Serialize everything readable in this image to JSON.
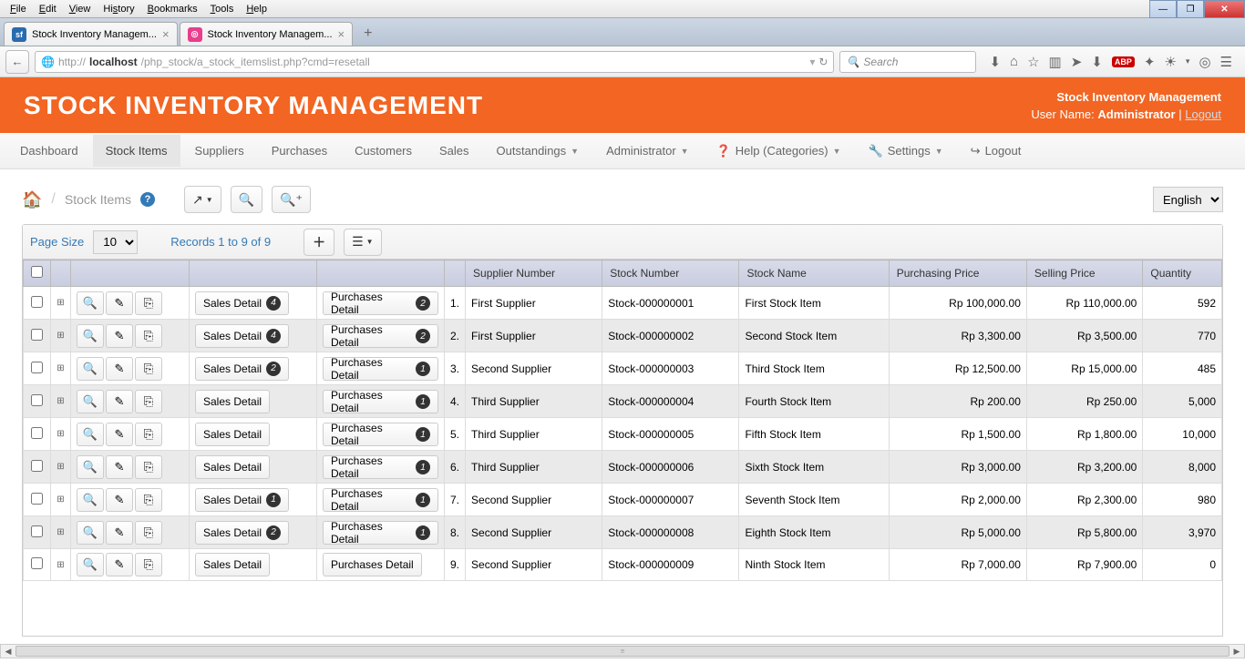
{
  "os_menu": [
    "File",
    "Edit",
    "View",
    "History",
    "Bookmarks",
    "Tools",
    "Help"
  ],
  "browser": {
    "tabs": [
      {
        "label": "Stock Inventory Managem...",
        "fav_bg": "#2a6aae",
        "fav_tx": "sf"
      },
      {
        "label": "Stock Inventory Managem...",
        "fav_bg": "#e83e8c",
        "fav_tx": "◎"
      }
    ],
    "url_scheme": "http://",
    "url_host": "localhost",
    "url_path": "/php_stock/a_stock_itemslist.php?cmd=resetall",
    "search_placeholder": "Search"
  },
  "header": {
    "title": "STOCK INVENTORY MANAGEMENT",
    "right_title": "Stock Inventory Management",
    "user_label": "User Name:",
    "user_name": "Administrator",
    "logout": "Logout"
  },
  "nav": {
    "dashboard": "Dashboard",
    "stock_items": "Stock Items",
    "suppliers": "Suppliers",
    "purchases": "Purchases",
    "customers": "Customers",
    "sales": "Sales",
    "outstandings": "Outstandings",
    "administrator": "Administrator",
    "help": "Help (Categories)",
    "settings": "Settings",
    "logout": "Logout"
  },
  "breadcrumb": {
    "current": "Stock Items"
  },
  "language": "English",
  "paging": {
    "page_size_label": "Page Size",
    "page_size": "10",
    "records_info": "Records 1 to 9 of 9"
  },
  "columns": {
    "supplier": "Supplier Number",
    "stock_no": "Stock Number",
    "stock_name": "Stock Name",
    "purchase": "Purchasing Price",
    "selling": "Selling Price",
    "qty": "Quantity"
  },
  "labels": {
    "sales_detail": "Sales Detail",
    "purchases_detail": "Purchases Detail"
  },
  "rows": [
    {
      "n": "1.",
      "supplier": "First Supplier",
      "stock_no": "Stock-000000001",
      "stock_name": "First Stock Item",
      "purchase": "Rp 100,000.00",
      "selling": "Rp 110,000.00",
      "qty": "592",
      "sales_badge": "4",
      "purch_badge": "2"
    },
    {
      "n": "2.",
      "supplier": "First Supplier",
      "stock_no": "Stock-000000002",
      "stock_name": "Second Stock Item",
      "purchase": "Rp 3,300.00",
      "selling": "Rp 3,500.00",
      "qty": "770",
      "sales_badge": "4",
      "purch_badge": "2"
    },
    {
      "n": "3.",
      "supplier": "Second Supplier",
      "stock_no": "Stock-000000003",
      "stock_name": "Third Stock Item",
      "purchase": "Rp 12,500.00",
      "selling": "Rp 15,000.00",
      "qty": "485",
      "sales_badge": "2",
      "purch_badge": "1"
    },
    {
      "n": "4.",
      "supplier": "Third Supplier",
      "stock_no": "Stock-000000004",
      "stock_name": "Fourth Stock Item",
      "purchase": "Rp 200.00",
      "selling": "Rp 250.00",
      "qty": "5,000",
      "sales_badge": "",
      "purch_badge": "1"
    },
    {
      "n": "5.",
      "supplier": "Third Supplier",
      "stock_no": "Stock-000000005",
      "stock_name": "Fifth Stock Item",
      "purchase": "Rp 1,500.00",
      "selling": "Rp 1,800.00",
      "qty": "10,000",
      "sales_badge": "",
      "purch_badge": "1"
    },
    {
      "n": "6.",
      "supplier": "Third Supplier",
      "stock_no": "Stock-000000006",
      "stock_name": "Sixth Stock Item",
      "purchase": "Rp 3,000.00",
      "selling": "Rp 3,200.00",
      "qty": "8,000",
      "sales_badge": "",
      "purch_badge": "1"
    },
    {
      "n": "7.",
      "supplier": "Second Supplier",
      "stock_no": "Stock-000000007",
      "stock_name": "Seventh Stock Item",
      "purchase": "Rp 2,000.00",
      "selling": "Rp 2,300.00",
      "qty": "980",
      "sales_badge": "1",
      "purch_badge": "1"
    },
    {
      "n": "8.",
      "supplier": "Second Supplier",
      "stock_no": "Stock-000000008",
      "stock_name": "Eighth Stock Item",
      "purchase": "Rp 5,000.00",
      "selling": "Rp 5,800.00",
      "qty": "3,970",
      "sales_badge": "2",
      "purch_badge": "1"
    },
    {
      "n": "9.",
      "supplier": "Second Supplier",
      "stock_no": "Stock-000000009",
      "stock_name": "Ninth Stock Item",
      "purchase": "Rp 7,000.00",
      "selling": "Rp 7,900.00",
      "qty": "0",
      "sales_badge": "",
      "purch_badge": ""
    }
  ]
}
